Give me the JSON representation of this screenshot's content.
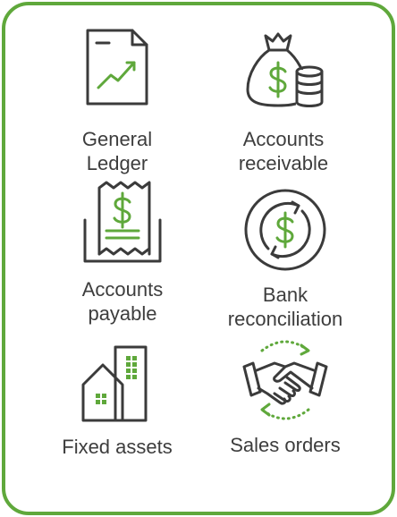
{
  "items": [
    {
      "label": "General\nLedger",
      "icon": "ledger-chart-icon"
    },
    {
      "label": "Accounts\nreceivable",
      "icon": "money-bag-coins-icon"
    },
    {
      "label": "Accounts\npayable",
      "icon": "receipt-icon"
    },
    {
      "label": "Bank\nreconciliation",
      "icon": "dollar-cycle-icon"
    },
    {
      "label": "Fixed assets",
      "icon": "buildings-icon"
    },
    {
      "label": "Sales orders",
      "icon": "handshake-icon"
    }
  ],
  "colors": {
    "border": "#5fa83b",
    "accent": "#5fa83b",
    "ink": "#3b3b3b",
    "text": "#3d3d3d"
  }
}
